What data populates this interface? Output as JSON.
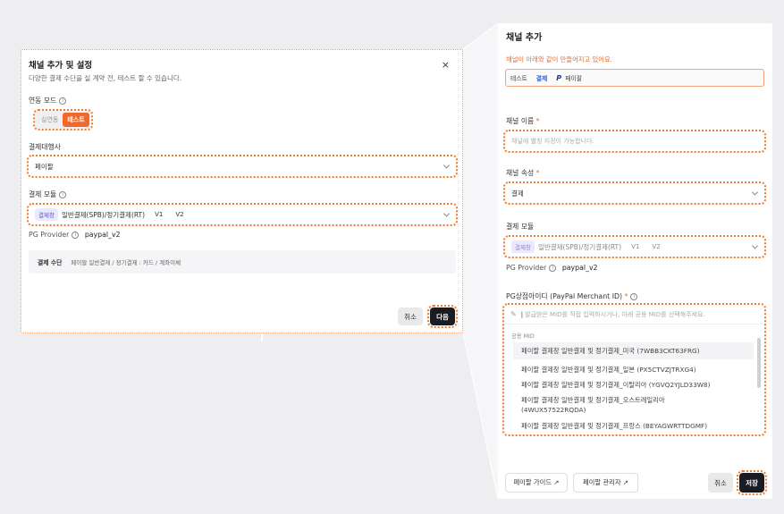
{
  "left_modal": {
    "title": "채널 추가 및 설정",
    "close": "×",
    "subtitle": "다양한 결제 수단을 실 계약 전, 테스트 할 수 있습니다.",
    "link_mode_label": "연동 모드",
    "mode_options": [
      "실연동",
      "테스트"
    ],
    "pg_label": "결제대행사",
    "pg_value": "페이팔",
    "module_label": "결제 모듈",
    "module_chip": "결제창",
    "module_name": "일반결제(SPB)/정기결제(RT)",
    "module_v1": "V1",
    "module_v2": "V2",
    "pg_provider_label": "PG Provider",
    "pg_provider_value": "paypal_v2",
    "method_label": "결제 수단",
    "method_value": "페이팔 일반결제 / 정기결제 : 카드 / 계좌이체",
    "cancel": "취소",
    "next": "다음"
  },
  "right_panel": {
    "title": "채널 추가",
    "warning": "채널이 아래와 같이 만들어지고 있어요.",
    "tabs": [
      "테스트",
      "결제",
      "페이팔"
    ],
    "channel_name_label": "채널 이름",
    "channel_name_placeholder": "채널에 별칭 지정이 가능합니다.",
    "channel_attr_label": "채널 속성",
    "channel_attr_value": "결제",
    "module_label": "결제 모듈",
    "module_chip": "결제창",
    "module_name": "일반결제(SPB)/정기결제(RT)",
    "module_v1": "V1",
    "module_v2": "V2",
    "pg_provider_label": "PG Provider",
    "pg_provider_value": "paypal_v2",
    "merchant_label": "PG상점아이디 (PayPal Merchant ID)",
    "merchant_placeholder": "발급받은 MID를 직접 입력하시거나, 아래 공용 MID를 선택해주세요.",
    "shared_mid_head": "공용 MID",
    "mids": [
      "페이팔 결제창 일반결제 및 정기결제_미국 (7WBB3CKT63FRG)",
      "페이팔 결제창 일반결제 및 정기결제_일본 (PX5CTVZJTRXG4)",
      "페이팔 결제창 일반결제 및 정기결제_이탈리아 (YGVQ2YJLD33W8)",
      "페이팔 결제창 일반결제 및 정기결제_오스트레일리아",
      "(4WUX57522RQDA)",
      "페이팔 결제창 일반결제 및 정기결제_프랑스 (BEYAGWRTTDGMF)"
    ],
    "guide_button": "페이팔 가이드 ↗",
    "admin_button": "페이팔 관리자 ↗",
    "cancel": "취소",
    "save": "저장"
  },
  "colors": {
    "accent": "#f0692c",
    "dark_button": "#1b1b24",
    "chip": "#5a4fcf"
  }
}
